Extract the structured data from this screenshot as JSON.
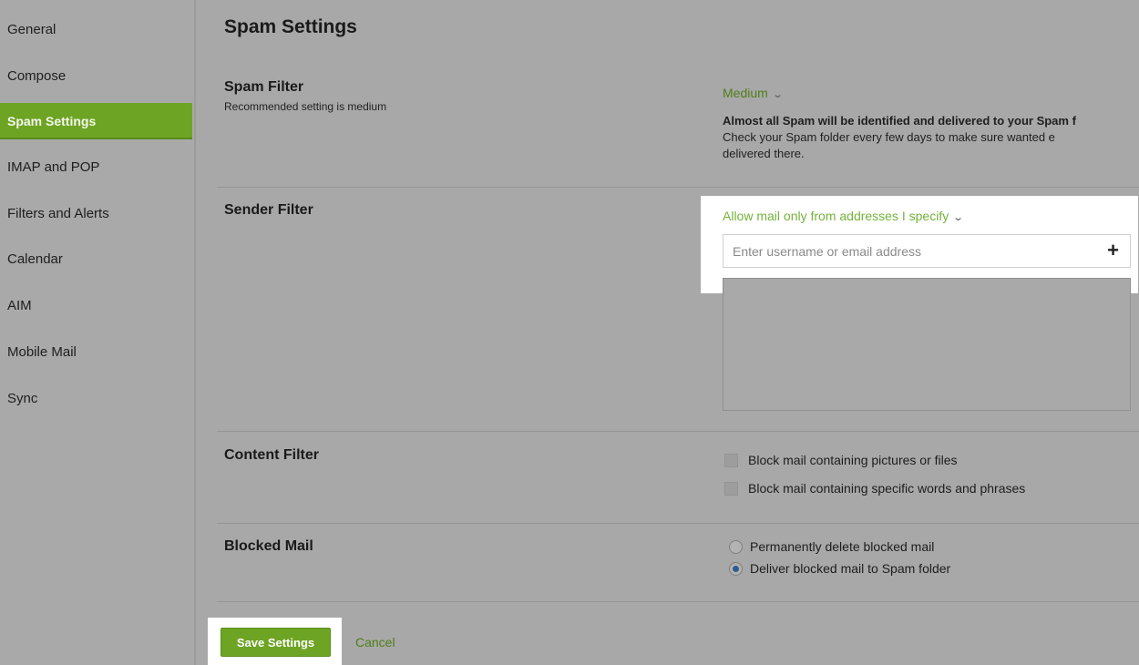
{
  "sidebar": {
    "items": [
      {
        "label": "General"
      },
      {
        "label": "Compose"
      },
      {
        "label": "Spam Settings"
      },
      {
        "label": "IMAP and POP"
      },
      {
        "label": "Filters and Alerts"
      },
      {
        "label": "Calendar"
      },
      {
        "label": "AIM"
      },
      {
        "label": "Mobile Mail"
      },
      {
        "label": "Sync"
      }
    ],
    "active_item": "Spam Settings"
  },
  "page": {
    "title": "Spam Settings"
  },
  "spam_filter": {
    "label": "Spam Filter",
    "sublabel": "Recommended setting is medium",
    "level": "Medium",
    "description_bold": "Almost all Spam will be identified and delivered to your Spam f",
    "description_line2": "Check your Spam folder every few days to make sure wanted e",
    "description_line3": "delivered there."
  },
  "sender_filter": {
    "label": "Sender Filter",
    "mode": "Allow mail only from addresses I specify",
    "input_placeholder": "Enter username or email address",
    "input_value": "",
    "addresses": []
  },
  "content_filter": {
    "label": "Content Filter",
    "options": [
      {
        "label": "Block mail containing pictures or files",
        "checked": false
      },
      {
        "label": "Block mail containing specific words and phrases",
        "checked": false
      }
    ]
  },
  "blocked_mail": {
    "label": "Blocked Mail",
    "options": [
      {
        "label": "Permanently delete blocked mail",
        "selected": false
      },
      {
        "label": "Deliver blocked mail to Spam folder",
        "selected": true
      }
    ]
  },
  "actions": {
    "save_label": "Save Settings",
    "cancel_label": "Cancel"
  },
  "colors": {
    "accent_green": "#6ea424",
    "link_green": "#4f7f17",
    "highlight": "#ffffff"
  }
}
